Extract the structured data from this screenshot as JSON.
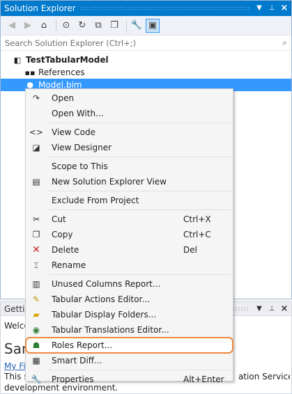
{
  "solution_explorer": {
    "title": "Solution Explorer",
    "search_placeholder": "Search Solution Explorer (Ctrl+;)",
    "tree": {
      "root": "TestTabularModel",
      "references": "References",
      "model": "Model.bim"
    }
  },
  "getting_started": {
    "title": "Getti",
    "welcome": "Welco",
    "heading": "San",
    "link": "My Fir",
    "line1_left": "This sa",
    "line1_right": "ation Services",
    "line2": "development environment."
  },
  "context_menu": {
    "items": [
      {
        "label": "Open",
        "icon": "redo-arrow-icon",
        "shortcut": ""
      },
      {
        "label": "Open With...",
        "icon": "",
        "shortcut": ""
      },
      {
        "label": "View Code",
        "icon": "code-brackets-icon",
        "shortcut": ""
      },
      {
        "label": "View Designer",
        "icon": "designer-icon",
        "shortcut": ""
      },
      {
        "label": "Scope to This",
        "icon": "",
        "shortcut": ""
      },
      {
        "label": "New Solution Explorer View",
        "icon": "new-view-icon",
        "shortcut": ""
      },
      {
        "label": "Exclude From Project",
        "icon": "",
        "shortcut": ""
      },
      {
        "label": "Cut",
        "icon": "scissors-icon",
        "shortcut": "Ctrl+X"
      },
      {
        "label": "Copy",
        "icon": "copy-icon",
        "shortcut": "Ctrl+C"
      },
      {
        "label": "Delete",
        "icon": "delete-x-icon",
        "shortcut": "Del"
      },
      {
        "label": "Rename",
        "icon": "rename-icon",
        "shortcut": ""
      },
      {
        "label": "Unused Columns Report...",
        "icon": "report-icon",
        "shortcut": ""
      },
      {
        "label": "Tabular Actions Editor...",
        "icon": "actions-editor-icon",
        "shortcut": ""
      },
      {
        "label": "Tabular Display Folders...",
        "icon": "folders-icon",
        "shortcut": ""
      },
      {
        "label": "Tabular Translations Editor...",
        "icon": "translations-icon",
        "shortcut": ""
      },
      {
        "label": "Roles Report...",
        "icon": "roles-icon",
        "shortcut": ""
      },
      {
        "label": "Smart Diff...",
        "icon": "diff-icon",
        "shortcut": ""
      },
      {
        "label": "Properties",
        "icon": "wrench-icon",
        "shortcut": "Alt+Enter"
      }
    ]
  },
  "colors": {
    "titlebar": "#007acc",
    "selection": "#3399ff",
    "highlight_outline": "#f0883e"
  }
}
